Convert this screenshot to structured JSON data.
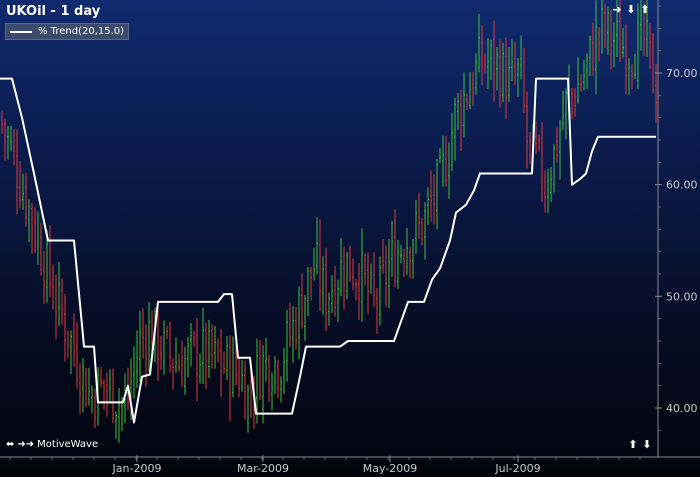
{
  "window": {
    "title": "UKOil - 1 day",
    "brand": "MotiveWave"
  },
  "legend": {
    "label": "% Trend(20,15.0)",
    "line_color": "#ffffff"
  },
  "icons": {
    "top_right": [
      "right-arrow-icon",
      "down-arrow-icon",
      "up-arrow-icon"
    ],
    "bottom_right": [
      "up-arrow-icon",
      "down-arrow-icon"
    ],
    "bottom_left": [
      "left-right-arrow-icon",
      "double-right-arrow-icon"
    ]
  },
  "colors": {
    "up_bar": "#3fc23f",
    "down_bar": "#e03a3a",
    "trend_line": "#ffffff",
    "axis_text": "#c8c8c8"
  },
  "chart_data": {
    "type": "ohlc",
    "symbol": "UKOil",
    "timeframe": "1 day",
    "x_ticks": [
      "Jan-2009",
      "Mar-2009",
      "May-2009",
      "Jul-2009"
    ],
    "y_ticks": [
      40,
      50,
      60,
      70
    ],
    "ylim": [
      36.5,
      76
    ],
    "series": [
      {
        "name": "% Trend(20,15.0)",
        "type": "step-line",
        "points": [
          [
            0,
            69.5
          ],
          [
            12,
            69.5
          ],
          [
            22,
            66
          ],
          [
            34,
            61
          ],
          [
            48,
            55
          ],
          [
            74,
            55
          ],
          [
            84,
            45.5
          ],
          [
            94,
            45.5
          ],
          [
            98,
            40.5
          ],
          [
            123,
            40.5
          ],
          [
            128,
            42
          ],
          [
            134,
            38.7
          ],
          [
            142,
            42.8
          ],
          [
            150,
            43
          ],
          [
            158,
            49.5
          ],
          [
            218,
            49.5
          ],
          [
            224,
            50.2
          ],
          [
            232,
            50.2
          ],
          [
            238,
            44.5
          ],
          [
            250,
            44.5
          ],
          [
            256,
            39.5
          ],
          [
            292,
            39.5
          ],
          [
            300,
            42.8
          ],
          [
            306,
            45.5
          ],
          [
            340,
            45.5
          ],
          [
            348,
            46
          ],
          [
            394,
            46
          ],
          [
            402,
            48
          ],
          [
            408,
            49.5
          ],
          [
            424,
            49.5
          ],
          [
            432,
            51.5
          ],
          [
            440,
            52.5
          ],
          [
            450,
            55
          ],
          [
            456,
            57.5
          ],
          [
            466,
            58.2
          ],
          [
            474,
            59.5
          ],
          [
            480,
            61
          ],
          [
            532,
            61
          ],
          [
            536,
            69.5
          ],
          [
            568,
            69.5
          ],
          [
            572,
            60
          ],
          [
            580,
            60.5
          ],
          [
            586,
            61
          ],
          [
            592,
            63
          ],
          [
            598,
            64.3
          ],
          [
            656,
            64.3
          ]
        ]
      },
      {
        "name": "UKOil",
        "type": "ohlc-bars",
        "anchors": [
          [
            0,
            66
          ],
          [
            15,
            62
          ],
          [
            35,
            56
          ],
          [
            55,
            50
          ],
          [
            75,
            45
          ],
          [
            90,
            41
          ],
          [
            105,
            42
          ],
          [
            125,
            40
          ],
          [
            140,
            46
          ],
          [
            150,
            47
          ],
          [
            165,
            45
          ],
          [
            180,
            44
          ],
          [
            200,
            45
          ],
          [
            220,
            44
          ],
          [
            240,
            43
          ],
          [
            248,
            41
          ],
          [
            262,
            44
          ],
          [
            280,
            44
          ],
          [
            300,
            49
          ],
          [
            315,
            53
          ],
          [
            325,
            50
          ],
          [
            345,
            53
          ],
          [
            360,
            52
          ],
          [
            375,
            49
          ],
          [
            390,
            53
          ],
          [
            405,
            55
          ],
          [
            420,
            56
          ],
          [
            440,
            60
          ],
          [
            455,
            66
          ],
          [
            470,
            69
          ],
          [
            480,
            71
          ],
          [
            495,
            71
          ],
          [
            510,
            69
          ],
          [
            520,
            70
          ],
          [
            528,
            63
          ],
          [
            538,
            62
          ],
          [
            545,
            60
          ],
          [
            555,
            63
          ],
          [
            565,
            67
          ],
          [
            572,
            68
          ],
          [
            585,
            70
          ],
          [
            600,
            74
          ],
          [
            615,
            73
          ],
          [
            630,
            72
          ],
          [
            645,
            73
          ],
          [
            655,
            69
          ]
        ]
      }
    ]
  }
}
